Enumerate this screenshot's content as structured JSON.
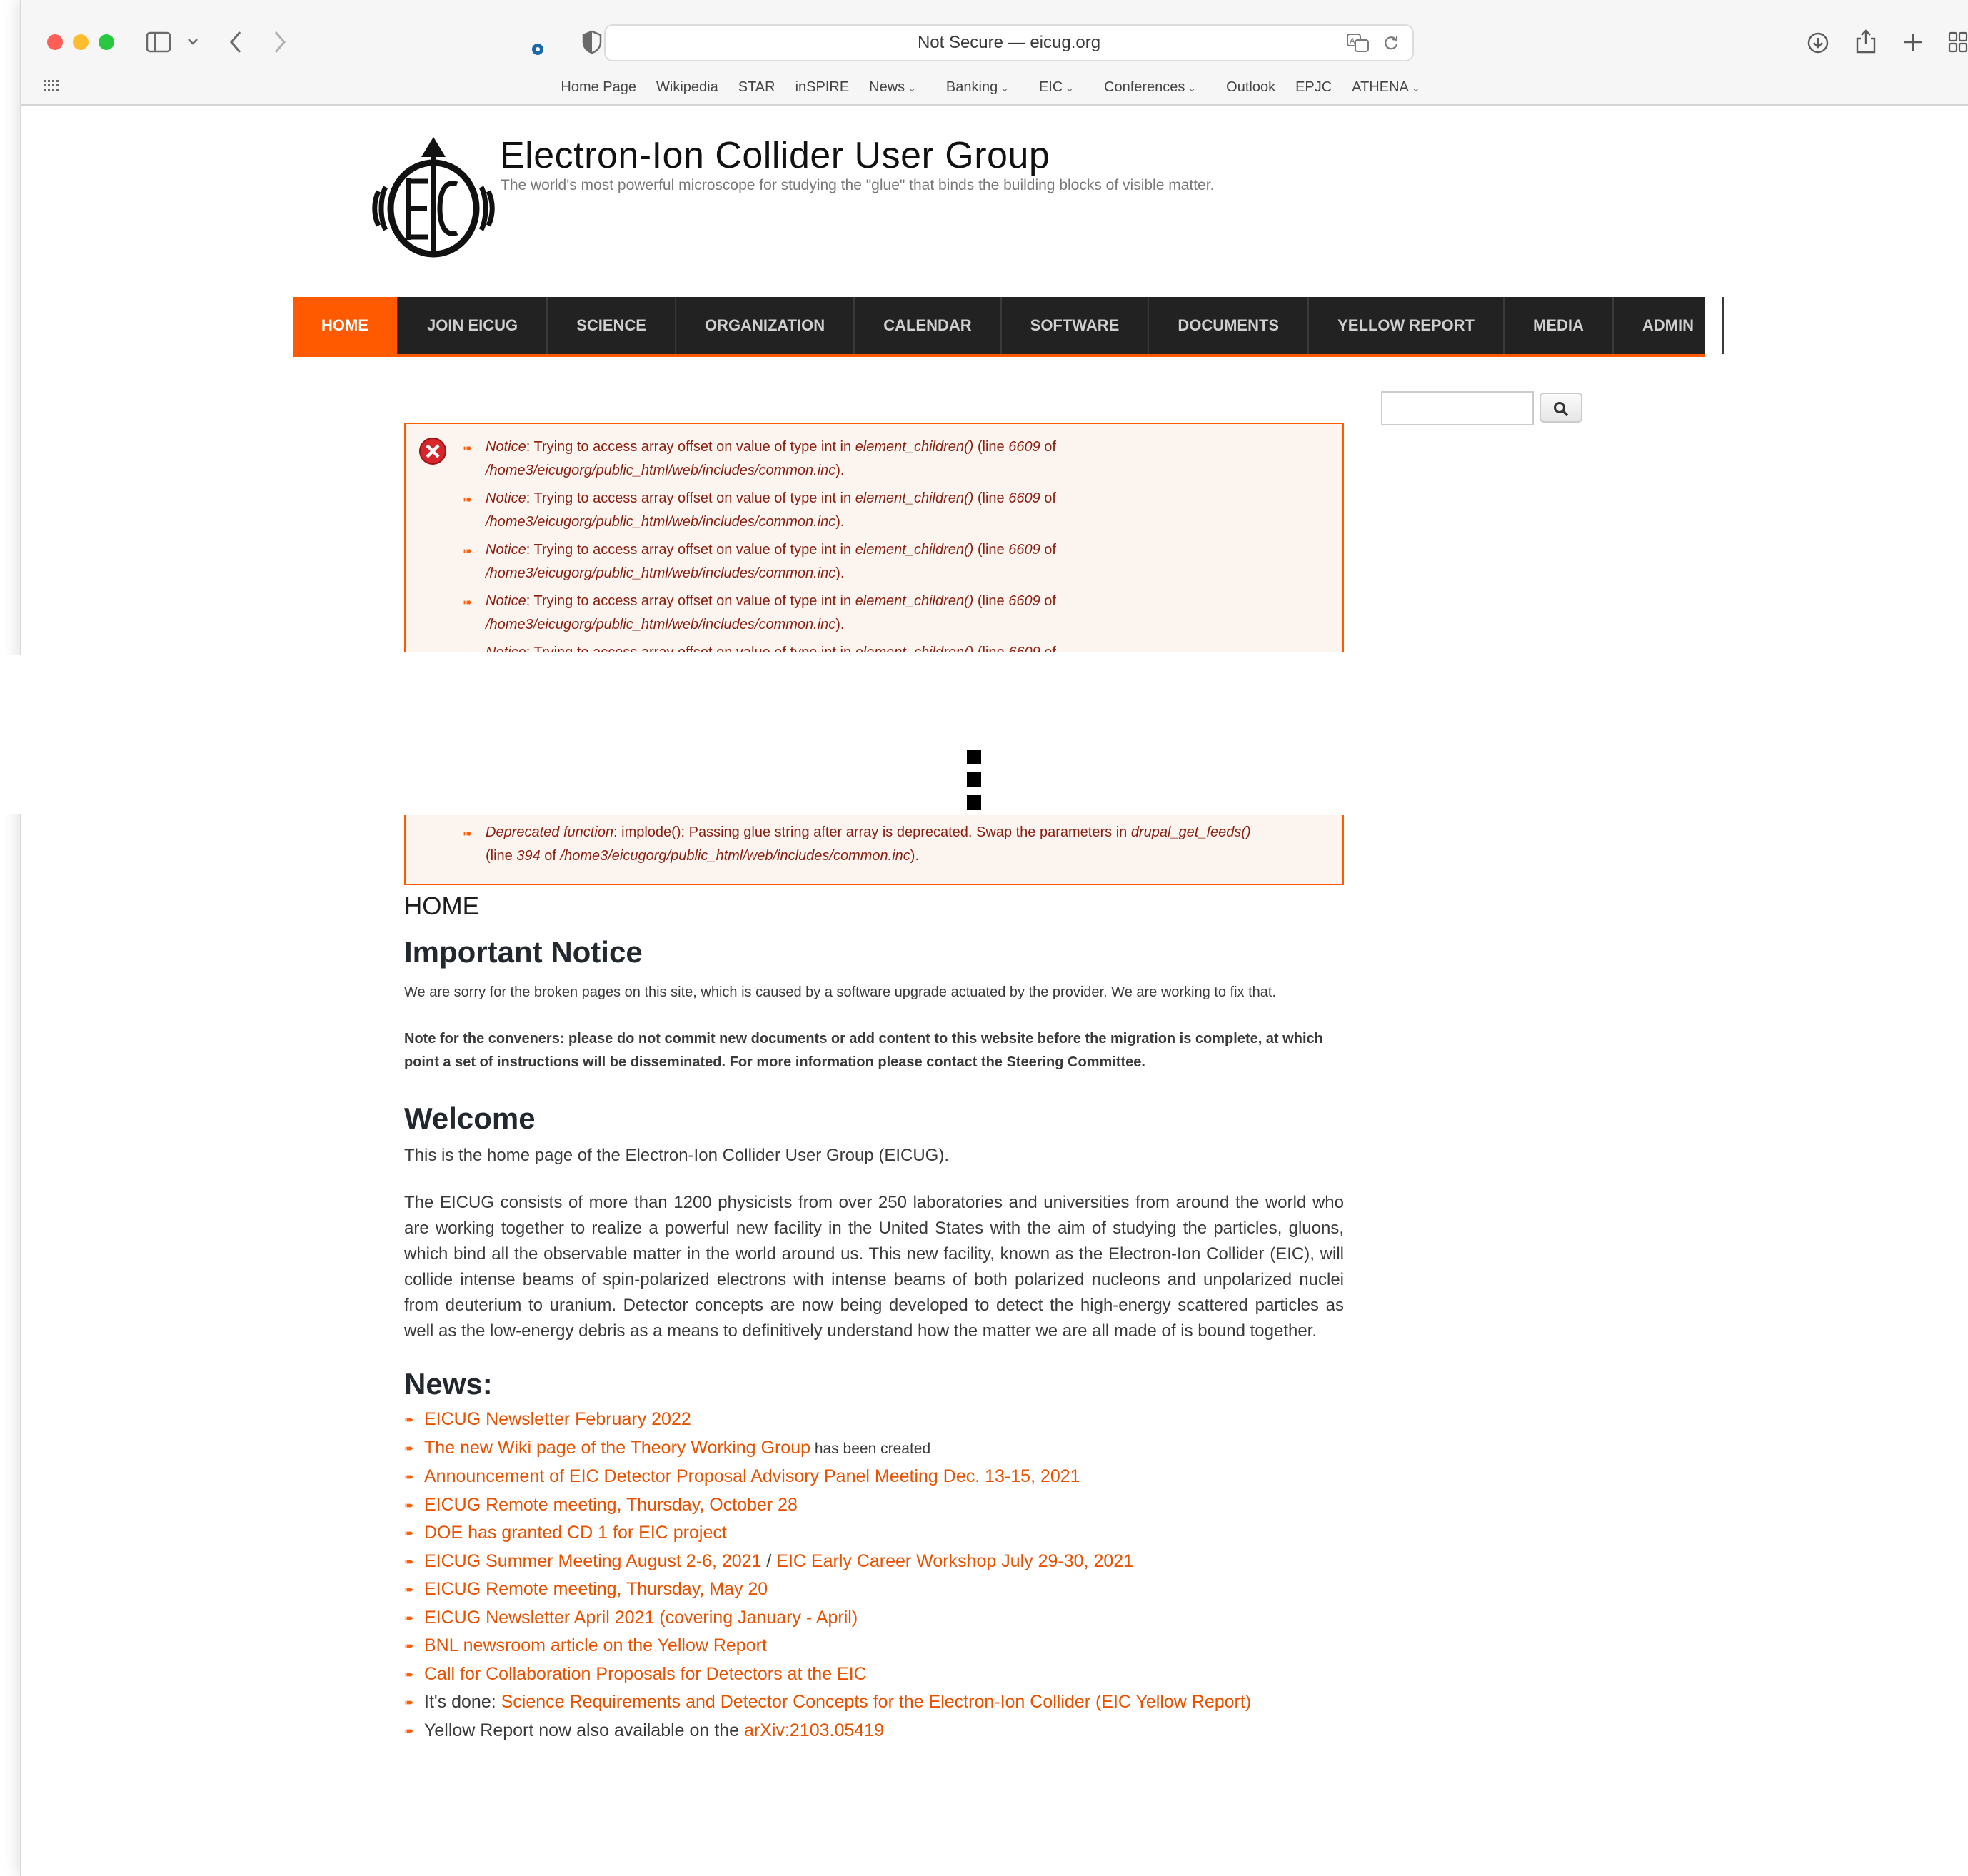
{
  "browser": {
    "address": "Not Secure — eicug.org",
    "bookmarks": [
      {
        "label": "Home Page",
        "menu": false
      },
      {
        "label": "Wikipedia",
        "menu": false
      },
      {
        "label": "STAR",
        "menu": false
      },
      {
        "label": "inSPIRE",
        "menu": false
      },
      {
        "label": "News",
        "menu": true
      },
      {
        "label": "Banking",
        "menu": true
      },
      {
        "label": "EIC",
        "menu": true
      },
      {
        "label": "Conferences",
        "menu": true
      },
      {
        "label": "Outlook",
        "menu": false
      },
      {
        "label": "EPJC",
        "menu": false
      },
      {
        "label": "ATHENA",
        "menu": true
      }
    ],
    "colors": {
      "close": "#ff5f57",
      "minimize": "#febc2e",
      "zoom": "#28c840"
    }
  },
  "site": {
    "title": "Electron-Ion Collider User Group",
    "slogan": "The world's most powerful microscope for studying the \"glue\" that binds the building blocks of visible matter.",
    "accent": "#ff5a00"
  },
  "nav": [
    {
      "label": "HOME",
      "active": true
    },
    {
      "label": "JOIN EICUG",
      "active": false
    },
    {
      "label": "SCIENCE",
      "active": false
    },
    {
      "label": "ORGANIZATION",
      "active": false
    },
    {
      "label": "CALENDAR",
      "active": false
    },
    {
      "label": "SOFTWARE",
      "active": false
    },
    {
      "label": "DOCUMENTS",
      "active": false
    },
    {
      "label": "YELLOW REPORT",
      "active": false
    },
    {
      "label": "MEDIA",
      "active": false
    },
    {
      "label": "ADMIN",
      "active": false
    }
  ],
  "messages": {
    "notice": {
      "type": "Notice",
      "text": ": Trying to access array offset on value of type int in ",
      "func": "element_children()",
      "line_prefix": " (line ",
      "line": "6609",
      "of": " of",
      "file": "/home3/eicugorg/public_html/web/includes/common.inc",
      "end": ")."
    },
    "notice_count": 5,
    "deprecated": {
      "type": "Deprecated function",
      "text": ": implode(): Passing glue string after array is deprecated. Swap the parameters in ",
      "func": "drupal_get_feeds()",
      "line_prefix": "(line ",
      "line": "394",
      "of": " of ",
      "file": "/home3/eicugorg/public_html/web/includes/common.inc",
      "end": ")."
    }
  },
  "main": {
    "breadcrumb": "HOME",
    "notice_heading": "Important Notice",
    "notice_text": "We are sorry for the broken pages on this site, which is caused by a software upgrade actuated by the provider. We are working to fix that.",
    "conveners_text": "Note for the conveners: please do not commit new documents or add content to this website before the migration is complete, at which point a set of instructions will be disseminated. For more information please contact the Steering Committee.",
    "welcome_heading": "Welcome",
    "welcome_intro": "This is the home page of the Electron-Ion Collider User Group (EICUG).",
    "welcome_body": "The EICUG consists of more than 1200 physicists from over 250 laboratories and universities from around the world who are working together to realize a powerful new facility in the United States with the aim of studying the particles, gluons, which bind all the observable matter in the world around us. This new facility, known as the Electron-Ion Collider (EIC), will collide intense beams of spin-polarized electrons with intense beams of both polarized nucleons and unpolarized nuclei from deuterium to uranium. Detector concepts are now being developed to detect the high-energy scattered particles as well as the low-energy debris as a means to definitively understand how the matter we are all made of is bound together.",
    "news_heading": "News:",
    "news": [
      {
        "pre": "",
        "link": "EICUG Newsletter February 2022",
        "post": "",
        "link2": ""
      },
      {
        "pre": "",
        "link": "The new Wiki page of the Theory Working Group",
        "post": " has been created",
        "link2": "",
        "small_post": true
      },
      {
        "pre": "",
        "link": "Announcement of EIC Detector Proposal Advisory Panel Meeting Dec. 13-15, 2021",
        "post": "",
        "link2": ""
      },
      {
        "pre": "",
        "link": "EICUG Remote meeting, Thursday, October 28",
        "post": "",
        "link2": ""
      },
      {
        "pre": "",
        "link": "DOE has granted CD 1 for EIC project",
        "post": "",
        "link2": ""
      },
      {
        "pre": "",
        "link": "EICUG Summer Meeting August 2-6, 2021",
        "post": " / ",
        "link2": "EIC Early Career Workshop July 29-30, 2021"
      },
      {
        "pre": "",
        "link": "EICUG Remote meeting, Thursday, May 20",
        "post": "",
        "link2": ""
      },
      {
        "pre": "",
        "link": "EICUG Newsletter April 2021 (covering January - April)",
        "post": "",
        "link2": ""
      },
      {
        "pre": "",
        "link": "BNL newsroom article on the Yellow Report",
        "post": "",
        "link2": ""
      },
      {
        "pre": "",
        "link": "Call for Collaboration Proposals for Detectors at the EIC",
        "post": "",
        "link2": ""
      },
      {
        "pre": "It's done: ",
        "link": "Science Requirements and Detector Concepts for the Electron-Ion Collider (EIC Yellow Report)",
        "post": "",
        "link2": ""
      },
      {
        "pre": "Yellow Report now also available on the ",
        "link": "arXiv:2103.05419",
        "post": "",
        "link2": ""
      }
    ]
  }
}
